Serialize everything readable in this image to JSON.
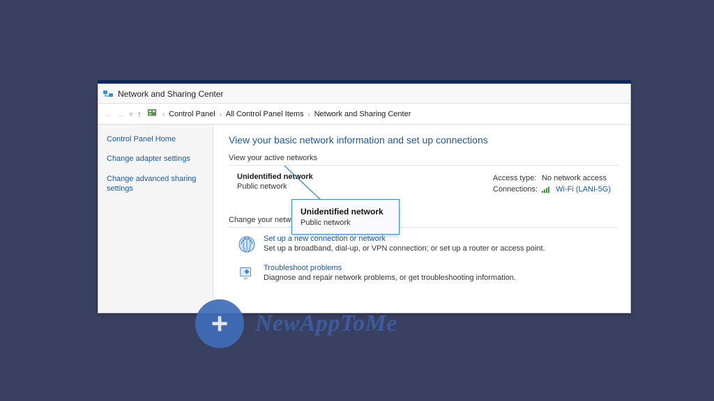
{
  "window": {
    "title": "Network and Sharing Center"
  },
  "breadcrumb": {
    "root_icon": "control-panel-icon",
    "items": [
      "Control Panel",
      "All Control Panel Items",
      "Network and Sharing Center"
    ]
  },
  "sidebar": {
    "items": [
      "Control Panel Home",
      "Change adapter settings",
      "Change advanced sharing settings"
    ]
  },
  "main": {
    "page_title": "View your basic network information and set up connections",
    "active_section_label": "View your active networks",
    "active_network": {
      "name": "Unidentified network",
      "type": "Public network"
    },
    "access": {
      "access_label": "Access type:",
      "access_value": "No network access",
      "connections_label": "Connections:",
      "connection_name": "Wi-Fi (LANI-5G)"
    },
    "change_section_label": "Change your network settings",
    "tasks": [
      {
        "title": "Set up a new connection or network",
        "desc": "Set up a broadband, dial-up, or VPN connection; or set up a router or access point."
      },
      {
        "title": "Troubleshoot problems",
        "desc": "Diagnose and repair network problems, or get troubleshooting information."
      }
    ]
  },
  "callout": {
    "title": "Unidentified network",
    "sub": "Public network"
  },
  "watermark": {
    "text": "NewAppToMe"
  }
}
